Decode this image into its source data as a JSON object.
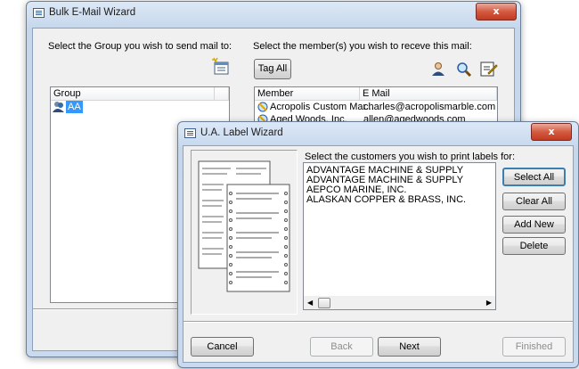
{
  "bulk": {
    "title": "Bulk E-Mail Wizard",
    "close": "x",
    "group_prompt": "Select the Group you wish to send mail to:",
    "member_prompt": "Select the member(s) you wish to receve this mail:",
    "tag_all_label": "Tag All",
    "group_column": "Group",
    "groups": [
      "AA"
    ],
    "member_columns": [
      "Member",
      "E Mail"
    ],
    "members": [
      {
        "name": "Acropolis Custom Mar...",
        "email": "charles@acropolismarble.com"
      },
      {
        "name": "Aged Woods, Inc.",
        "email": "allen@agedwoods.com"
      }
    ]
  },
  "label": {
    "title": "U.A. Label Wizard",
    "close": "x",
    "prompt": "Select the customers you wish to print labels for:",
    "customers": [
      "ADVANTAGE MACHINE & SUPPLY",
      "ADVANTAGE MACHINE & SUPPLY",
      "AEPCO MARINE, INC.",
      "ALASKAN COPPER & BRASS, INC."
    ],
    "buttons": {
      "select_all": "Select All",
      "clear_all": "Clear All",
      "add_new": "Add New",
      "delete": "Delete"
    },
    "footer": {
      "cancel": "Cancel",
      "back": "Back",
      "next": "Next",
      "finished": "Finished"
    }
  },
  "colors": {
    "title_close": "#c13b22",
    "selection": "#3399ff",
    "window_frame": "#c6d7ec"
  }
}
